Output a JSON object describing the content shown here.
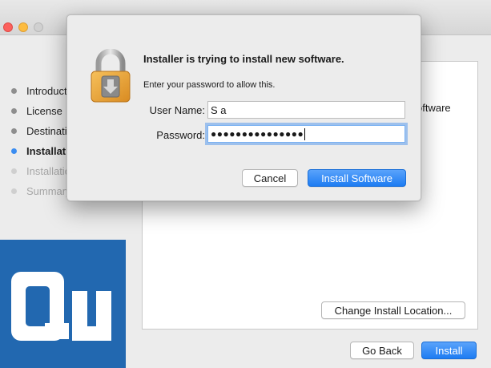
{
  "window": {
    "steps": [
      {
        "label": "Introduction",
        "state": "done"
      },
      {
        "label": "License",
        "state": "done"
      },
      {
        "label": "Destination Select",
        "state": "done"
      },
      {
        "label": "Installation Type",
        "state": "current"
      },
      {
        "label": "Installation",
        "state": "pending"
      },
      {
        "label": "Summary",
        "state": "pending"
      }
    ],
    "content_snippet": "oftware",
    "change_location_label": "Change Install Location...",
    "go_back_label": "Go Back",
    "install_label": "Install",
    "logo_text": "Qu"
  },
  "dialog": {
    "title": "Installer is trying to install new software.",
    "subtitle": "Enter your password to allow this.",
    "username_label": "User Name:",
    "username_value": "S a",
    "password_label": "Password:",
    "password_value": "●●●●●●●●●●●●●●●",
    "cancel_label": "Cancel",
    "install_software_label": "Install Software"
  },
  "colors": {
    "accent": "#1d7cf2",
    "logo_blue": "#2268b0",
    "lock_gold": "#e9a23b"
  }
}
